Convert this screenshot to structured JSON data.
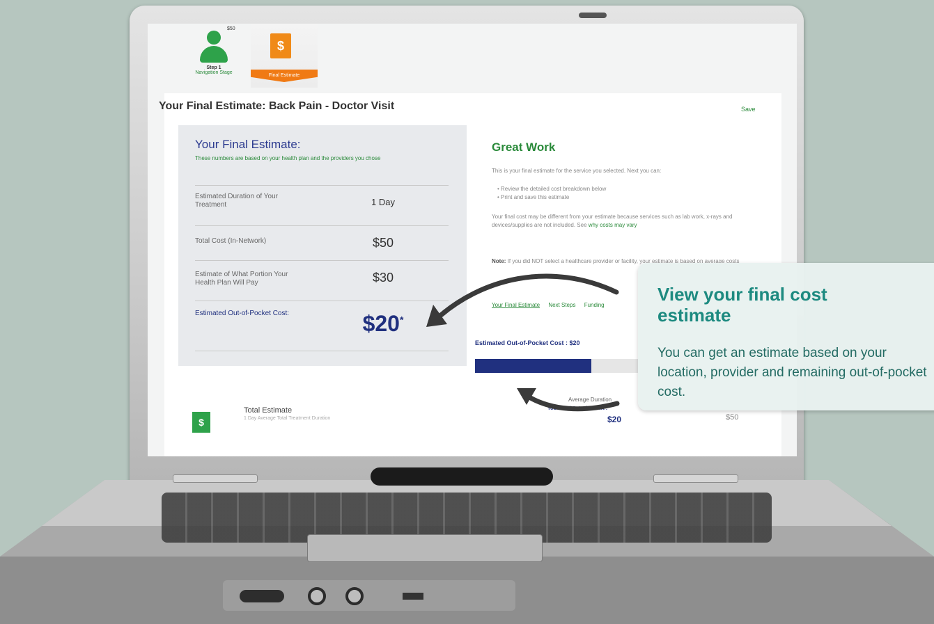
{
  "steps": {
    "step1": {
      "cost": "$50",
      "number": "Step 1",
      "label": "Navigation Stage"
    },
    "step2": {
      "label": "Final Estimate",
      "icon_glyph": "$"
    }
  },
  "page": {
    "title": "Your Final Estimate:   Back Pain - Doctor Visit",
    "save_label": "Save"
  },
  "estimate": {
    "title": "Your Final Estimate:",
    "subtitle": "These numbers are based on your health plan and the providers you chose",
    "rows": [
      {
        "label": "Estimated Duration of Your Treatment",
        "value": "1 Day"
      },
      {
        "label": "Total Cost (In-Network)",
        "value": "$50"
      },
      {
        "label": "Estimate of What Portion Your Health Plan Will Pay",
        "value": "$30"
      },
      {
        "label": "Estimated Out-of-Pocket Cost:",
        "value": "$20",
        "footnote": "*"
      }
    ]
  },
  "great_work": {
    "title": "Great Work",
    "intro": "This is your final estimate for the service you selected. Next you can:",
    "bullets": [
      "Review the detailed cost breakdown below",
      "Print and save this estimate"
    ],
    "note1": "Your final cost may be different from your estimate because services such as lab work, x-rays and devices/supplies are not included. See",
    "note1_link": "why costs may vary",
    "note2_bold": "Note:",
    "note2": "If you did NOT select a healthcare provider or facility, your estimate is based on average costs",
    "tabs": [
      "Your Final Estimate",
      "Next Steps",
      "Funding"
    ],
    "oop_label": "Estimated Out-of-Pocket Cost : $20",
    "progress_fraction": 0.44,
    "avg_duration_label": "Average Duration"
  },
  "total": {
    "icon_glyph": "$",
    "title": "Total Estimate",
    "subtitle": "1 Day Average Total Treatment Duration",
    "oop_label": "Your Total Out-of-Pocket :",
    "oop_value": "$20",
    "total_value": "$50"
  },
  "callout": {
    "heading": "View your final cost estimate",
    "body": "You can get an estimate based on your location, provider and remaining out-of-pocket cost."
  },
  "colors": {
    "accent_green": "#2a8a3a",
    "navy": "#20307f",
    "orange": "#f07a14",
    "teal": "#1d8a80"
  }
}
